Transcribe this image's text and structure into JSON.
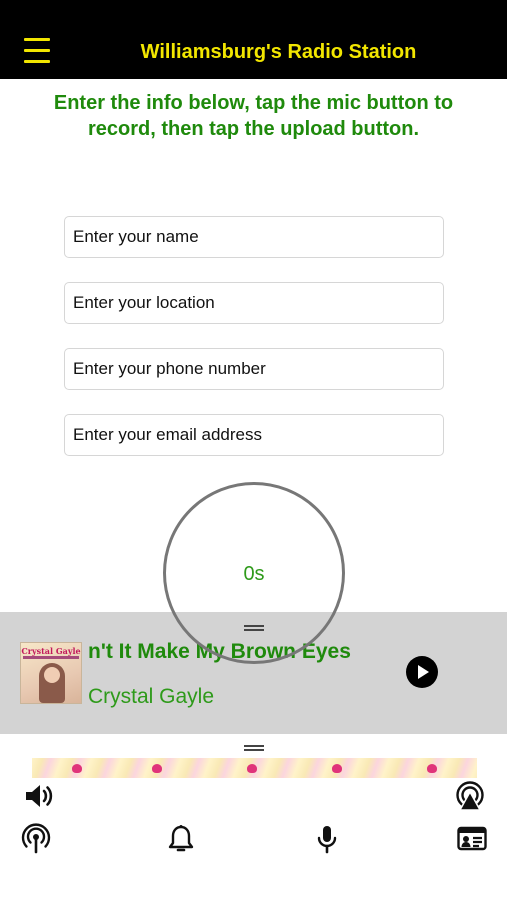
{
  "header": {
    "title": "Williamsburg's Radio Station",
    "menu_icon": "hamburger-menu-icon"
  },
  "instructions": "Enter the info below, tap the mic button to record, then tap the upload button.",
  "form": {
    "name_placeholder": "Enter your name",
    "location_placeholder": "Enter your location",
    "phone_placeholder": "Enter your phone number",
    "email_placeholder": "Enter your email address"
  },
  "recorder": {
    "elapsed": "0s"
  },
  "now_playing": {
    "title": "Don't It Make My Brown Eyes Blue",
    "artist": "Crystal Gayle",
    "album_art_text": "Crystal Gayle",
    "play_icon": "play-icon"
  },
  "toolbar": {
    "volume_icon": "volume-icon",
    "airplay_icon": "airplay-icon",
    "icons": [
      "podcast-icon",
      "bell-icon",
      "microphone-icon",
      "contact-card-icon"
    ]
  },
  "colors": {
    "header_bg": "#000000",
    "header_text": "#f2e600",
    "accent_green": "#1f8a0c",
    "player_bg": "#d3d3d3"
  }
}
